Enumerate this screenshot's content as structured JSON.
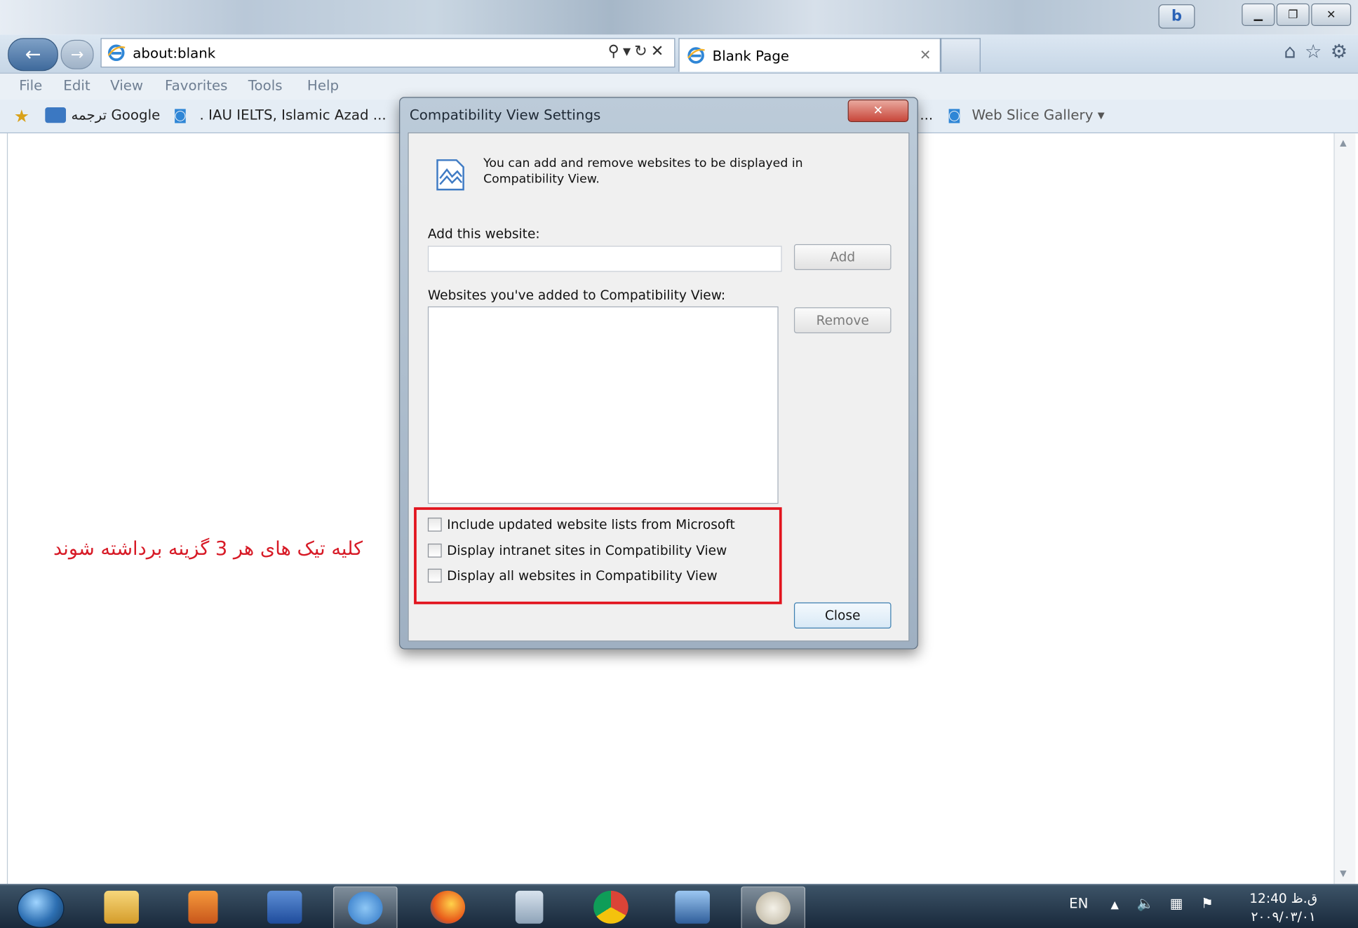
{
  "browser": {
    "address": "about:blank",
    "tab_title": "Blank Page",
    "menu": [
      "File",
      "Edit",
      "View",
      "Favorites",
      "Tools",
      "Help"
    ],
    "favorites": {
      "fav1": "ترجمه Google",
      "fav2": ". IAU IELTS, Islamic Azad ...",
      "fav_overflow": "...",
      "fav3": "Web Slice Gallery ▾"
    },
    "bing_label": "b"
  },
  "annotation": "کلیه تیک های هر 3 گزینه برداشته شوند",
  "dialog": {
    "title": "Compatibility View Settings",
    "close_glyph": "✕",
    "intro": "You can add and remove websites to be displayed in Compatibility View.",
    "add_label": "Add this website:",
    "add_input_value": "",
    "add_button": "Add",
    "list_label": "Websites you've added to Compatibility View:",
    "list_items": [],
    "remove_button": "Remove",
    "options": [
      {
        "label": "Include updated website lists from Microsoft",
        "checked": false
      },
      {
        "label": "Display intranet sites in Compatibility View",
        "checked": false
      },
      {
        "label": "Display all websites in Compatibility View",
        "checked": false
      }
    ],
    "close_button": "Close"
  },
  "taskbar": {
    "lang": "EN",
    "time": "12:40 ق.ظ",
    "date": "۲۰۰۹/۰۳/۰۱"
  },
  "colors": {
    "annotation_red": "#d71a26",
    "highlight_red": "#e2141e",
    "dialog_close_red": "#c8463a"
  }
}
